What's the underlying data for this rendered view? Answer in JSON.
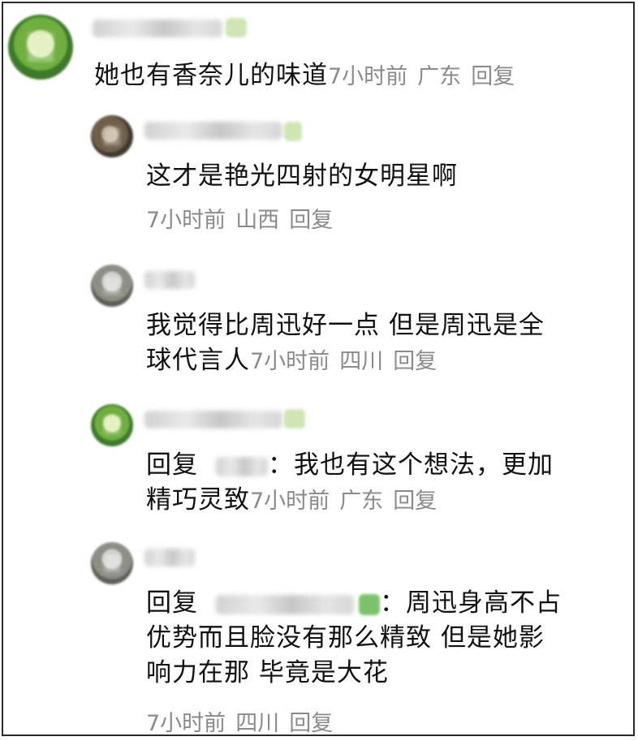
{
  "comments": [
    {
      "text": "她也有香奈儿的味道",
      "time": "7小时前",
      "location": "广东",
      "reply_label": "回复"
    },
    {
      "text": "这才是艳光四射的女明星啊",
      "time": "7小时前",
      "location": "山西",
      "reply_label": "回复"
    },
    {
      "text_line1": "我觉得比周迅好一点 但是周迅是全",
      "text_line2": "球代言人",
      "time": "7小时前",
      "location": "四川",
      "reply_label": "回复"
    },
    {
      "reply_prefix": "回复",
      "text_after_name": "：我也有这个想法，更加",
      "text_line2": "精巧灵致",
      "time": "7小时前",
      "location": "广东",
      "reply_label": "回复"
    },
    {
      "reply_prefix": "回复",
      "text_after_name": "：周迅身高不占",
      "text_line2": "优势而且脸没有那么精致 但是她影",
      "text_line3": "响力在那 毕竟是大花",
      "time": "7小时前",
      "location": "四川",
      "reply_label": "回复"
    }
  ]
}
